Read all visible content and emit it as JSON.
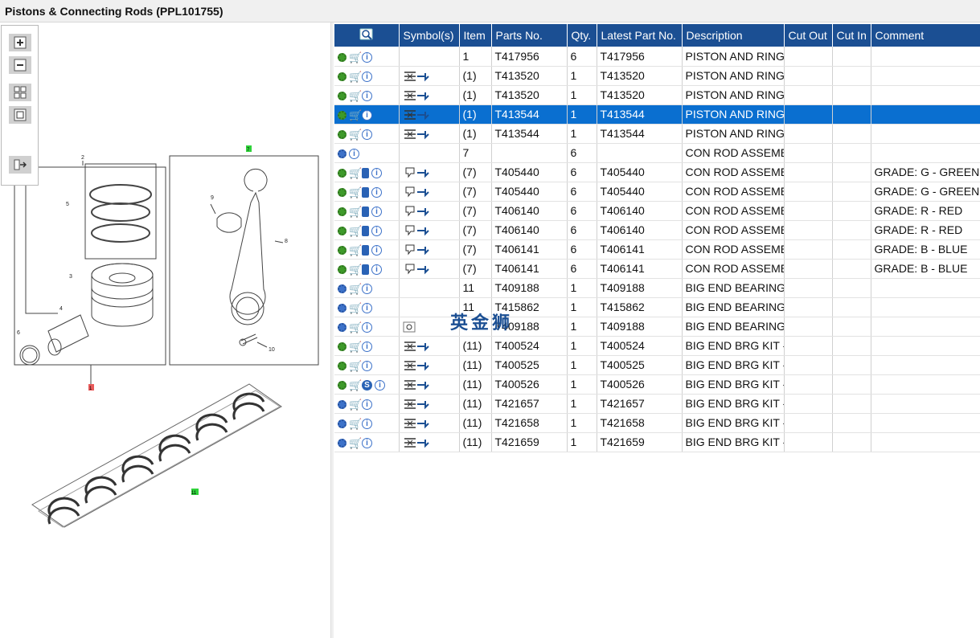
{
  "window": {
    "title": "Pistons & Connecting Rods (PPL101755)"
  },
  "toolbox": {
    "tools": [
      "zoom-in-icon",
      "zoom-out-icon",
      "fit-all-icon",
      "fit-page-icon",
      "export-icon"
    ]
  },
  "diagram": {
    "callouts": {
      "c1": "1",
      "c2": "2",
      "c3": "3",
      "c4": "4",
      "c5": "5",
      "c6": "6",
      "c7": "7",
      "c8": "8",
      "c9": "9",
      "c10": "10",
      "c11": "11"
    }
  },
  "table": {
    "headers": {
      "search_icon": "search-icon",
      "symbols": "Symbol(s)",
      "item": "Item",
      "parts_no": "Parts No.",
      "qty": "Qty.",
      "latest": "Latest Part No.",
      "desc": "Description",
      "cut_out": "Cut Out",
      "cut_in": "Cut In",
      "comment": "Comment"
    },
    "rows": [
      {
        "item": "1",
        "parts": "T417956",
        "qty": "6",
        "latest": "T417956",
        "desc": "PISTON AND RING",
        "comment": ""
      },
      {
        "item": "(1)",
        "parts": "T413520",
        "qty": "1",
        "latest": "T413520",
        "desc": "PISTON AND RING",
        "comment": ""
      },
      {
        "item": "(1)",
        "parts": "T413520",
        "qty": "1",
        "latest": "T413520",
        "desc": "PISTON AND RING",
        "comment": ""
      },
      {
        "item": "(1)",
        "parts": "T413544",
        "qty": "1",
        "latest": "T413544",
        "desc": "PISTON AND RING",
        "comment": ""
      },
      {
        "item": "(1)",
        "parts": "T413544",
        "qty": "1",
        "latest": "T413544",
        "desc": "PISTON AND RING",
        "comment": ""
      },
      {
        "item": "7",
        "parts": "",
        "qty": "6",
        "latest": "",
        "desc": "CON ROD ASSEME",
        "comment": ""
      },
      {
        "item": "(7)",
        "parts": "T405440",
        "qty": "6",
        "latest": "T405440",
        "desc": "CON ROD ASSEME",
        "comment": "GRADE: G - GREEN"
      },
      {
        "item": "(7)",
        "parts": "T405440",
        "qty": "6",
        "latest": "T405440",
        "desc": "CON ROD ASSEME",
        "comment": "GRADE: G - GREEN"
      },
      {
        "item": "(7)",
        "parts": "T406140",
        "qty": "6",
        "latest": "T406140",
        "desc": "CON ROD ASSEME",
        "comment": "GRADE: R - RED"
      },
      {
        "item": "(7)",
        "parts": "T406140",
        "qty": "6",
        "latest": "T406140",
        "desc": "CON ROD ASSEME",
        "comment": "GRADE: R - RED"
      },
      {
        "item": "(7)",
        "parts": "T406141",
        "qty": "6",
        "latest": "T406141",
        "desc": "CON ROD ASSEME",
        "comment": "GRADE: B - BLUE"
      },
      {
        "item": "(7)",
        "parts": "T406141",
        "qty": "6",
        "latest": "T406141",
        "desc": "CON ROD ASSEME",
        "comment": "GRADE: B - BLUE"
      },
      {
        "item": "11",
        "parts": "T409188",
        "qty": "1",
        "latest": "T409188",
        "desc": "BIG END BEARING",
        "comment": ""
      },
      {
        "item": "11",
        "parts": "T415862",
        "qty": "1",
        "latest": "T415862",
        "desc": "BIG END BEARING",
        "comment": ""
      },
      {
        "item": "",
        "parts": "T409188",
        "qty": "1",
        "latest": "T409188",
        "desc": "BIG END BEARING",
        "comment": ""
      },
      {
        "item": "(11)",
        "parts": "T400524",
        "qty": "1",
        "latest": "T400524",
        "desc": "BIG END BRG KIT -",
        "comment": ""
      },
      {
        "item": "(11)",
        "parts": "T400525",
        "qty": "1",
        "latest": "T400525",
        "desc": "BIG END BRG KIT -",
        "comment": ""
      },
      {
        "item": "(11)",
        "parts": "T400526",
        "qty": "1",
        "latest": "T400526",
        "desc": "BIG END BRG KIT -",
        "comment": ""
      },
      {
        "item": "(11)",
        "parts": "T421657",
        "qty": "1",
        "latest": "T421657",
        "desc": "BIG END BRG KIT -",
        "comment": ""
      },
      {
        "item": "(11)",
        "parts": "T421658",
        "qty": "1",
        "latest": "T421658",
        "desc": "BIG END BRG KIT -",
        "comment": ""
      },
      {
        "item": "(11)",
        "parts": "T421659",
        "qty": "1",
        "latest": "T421659",
        "desc": "BIG END BRG KIT -",
        "comment": ""
      }
    ]
  },
  "watermark": "英金狮",
  "colors": {
    "header_bg": "#1b4f93",
    "selected_row": "#0a6fd0",
    "callout_red": "#e85a5a",
    "callout_green": "#2fd23a"
  }
}
